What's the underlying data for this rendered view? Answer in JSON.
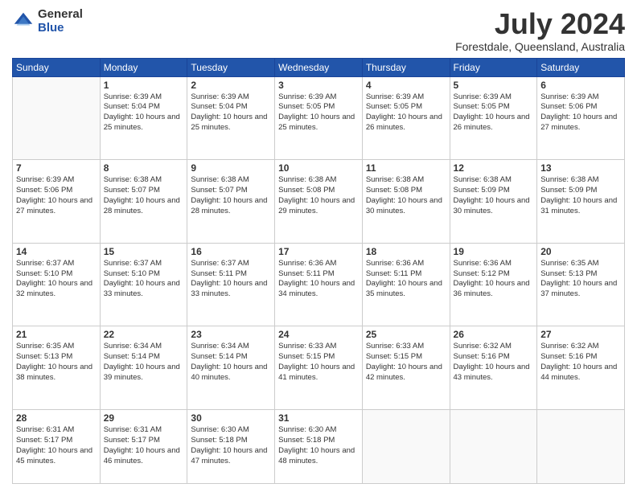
{
  "logo": {
    "general": "General",
    "blue": "Blue"
  },
  "title": "July 2024",
  "location": "Forestdale, Queensland, Australia",
  "days_of_week": [
    "Sunday",
    "Monday",
    "Tuesday",
    "Wednesday",
    "Thursday",
    "Friday",
    "Saturday"
  ],
  "weeks": [
    [
      {
        "day": "",
        "info": ""
      },
      {
        "day": "1",
        "info": "Sunrise: 6:39 AM\nSunset: 5:04 PM\nDaylight: 10 hours\nand 25 minutes."
      },
      {
        "day": "2",
        "info": "Sunrise: 6:39 AM\nSunset: 5:04 PM\nDaylight: 10 hours\nand 25 minutes."
      },
      {
        "day": "3",
        "info": "Sunrise: 6:39 AM\nSunset: 5:05 PM\nDaylight: 10 hours\nand 25 minutes."
      },
      {
        "day": "4",
        "info": "Sunrise: 6:39 AM\nSunset: 5:05 PM\nDaylight: 10 hours\nand 26 minutes."
      },
      {
        "day": "5",
        "info": "Sunrise: 6:39 AM\nSunset: 5:05 PM\nDaylight: 10 hours\nand 26 minutes."
      },
      {
        "day": "6",
        "info": "Sunrise: 6:39 AM\nSunset: 5:06 PM\nDaylight: 10 hours\nand 27 minutes."
      }
    ],
    [
      {
        "day": "7",
        "info": "Sunrise: 6:39 AM\nSunset: 5:06 PM\nDaylight: 10 hours\nand 27 minutes."
      },
      {
        "day": "8",
        "info": "Sunrise: 6:38 AM\nSunset: 5:07 PM\nDaylight: 10 hours\nand 28 minutes."
      },
      {
        "day": "9",
        "info": "Sunrise: 6:38 AM\nSunset: 5:07 PM\nDaylight: 10 hours\nand 28 minutes."
      },
      {
        "day": "10",
        "info": "Sunrise: 6:38 AM\nSunset: 5:08 PM\nDaylight: 10 hours\nand 29 minutes."
      },
      {
        "day": "11",
        "info": "Sunrise: 6:38 AM\nSunset: 5:08 PM\nDaylight: 10 hours\nand 30 minutes."
      },
      {
        "day": "12",
        "info": "Sunrise: 6:38 AM\nSunset: 5:09 PM\nDaylight: 10 hours\nand 30 minutes."
      },
      {
        "day": "13",
        "info": "Sunrise: 6:38 AM\nSunset: 5:09 PM\nDaylight: 10 hours\nand 31 minutes."
      }
    ],
    [
      {
        "day": "14",
        "info": "Sunrise: 6:37 AM\nSunset: 5:10 PM\nDaylight: 10 hours\nand 32 minutes."
      },
      {
        "day": "15",
        "info": "Sunrise: 6:37 AM\nSunset: 5:10 PM\nDaylight: 10 hours\nand 33 minutes."
      },
      {
        "day": "16",
        "info": "Sunrise: 6:37 AM\nSunset: 5:11 PM\nDaylight: 10 hours\nand 33 minutes."
      },
      {
        "day": "17",
        "info": "Sunrise: 6:36 AM\nSunset: 5:11 PM\nDaylight: 10 hours\nand 34 minutes."
      },
      {
        "day": "18",
        "info": "Sunrise: 6:36 AM\nSunset: 5:11 PM\nDaylight: 10 hours\nand 35 minutes."
      },
      {
        "day": "19",
        "info": "Sunrise: 6:36 AM\nSunset: 5:12 PM\nDaylight: 10 hours\nand 36 minutes."
      },
      {
        "day": "20",
        "info": "Sunrise: 6:35 AM\nSunset: 5:13 PM\nDaylight: 10 hours\nand 37 minutes."
      }
    ],
    [
      {
        "day": "21",
        "info": "Sunrise: 6:35 AM\nSunset: 5:13 PM\nDaylight: 10 hours\nand 38 minutes."
      },
      {
        "day": "22",
        "info": "Sunrise: 6:34 AM\nSunset: 5:14 PM\nDaylight: 10 hours\nand 39 minutes."
      },
      {
        "day": "23",
        "info": "Sunrise: 6:34 AM\nSunset: 5:14 PM\nDaylight: 10 hours\nand 40 minutes."
      },
      {
        "day": "24",
        "info": "Sunrise: 6:33 AM\nSunset: 5:15 PM\nDaylight: 10 hours\nand 41 minutes."
      },
      {
        "day": "25",
        "info": "Sunrise: 6:33 AM\nSunset: 5:15 PM\nDaylight: 10 hours\nand 42 minutes."
      },
      {
        "day": "26",
        "info": "Sunrise: 6:32 AM\nSunset: 5:16 PM\nDaylight: 10 hours\nand 43 minutes."
      },
      {
        "day": "27",
        "info": "Sunrise: 6:32 AM\nSunset: 5:16 PM\nDaylight: 10 hours\nand 44 minutes."
      }
    ],
    [
      {
        "day": "28",
        "info": "Sunrise: 6:31 AM\nSunset: 5:17 PM\nDaylight: 10 hours\nand 45 minutes."
      },
      {
        "day": "29",
        "info": "Sunrise: 6:31 AM\nSunset: 5:17 PM\nDaylight: 10 hours\nand 46 minutes."
      },
      {
        "day": "30",
        "info": "Sunrise: 6:30 AM\nSunset: 5:18 PM\nDaylight: 10 hours\nand 47 minutes."
      },
      {
        "day": "31",
        "info": "Sunrise: 6:30 AM\nSunset: 5:18 PM\nDaylight: 10 hours\nand 48 minutes."
      },
      {
        "day": "",
        "info": ""
      },
      {
        "day": "",
        "info": ""
      },
      {
        "day": "",
        "info": ""
      }
    ]
  ]
}
